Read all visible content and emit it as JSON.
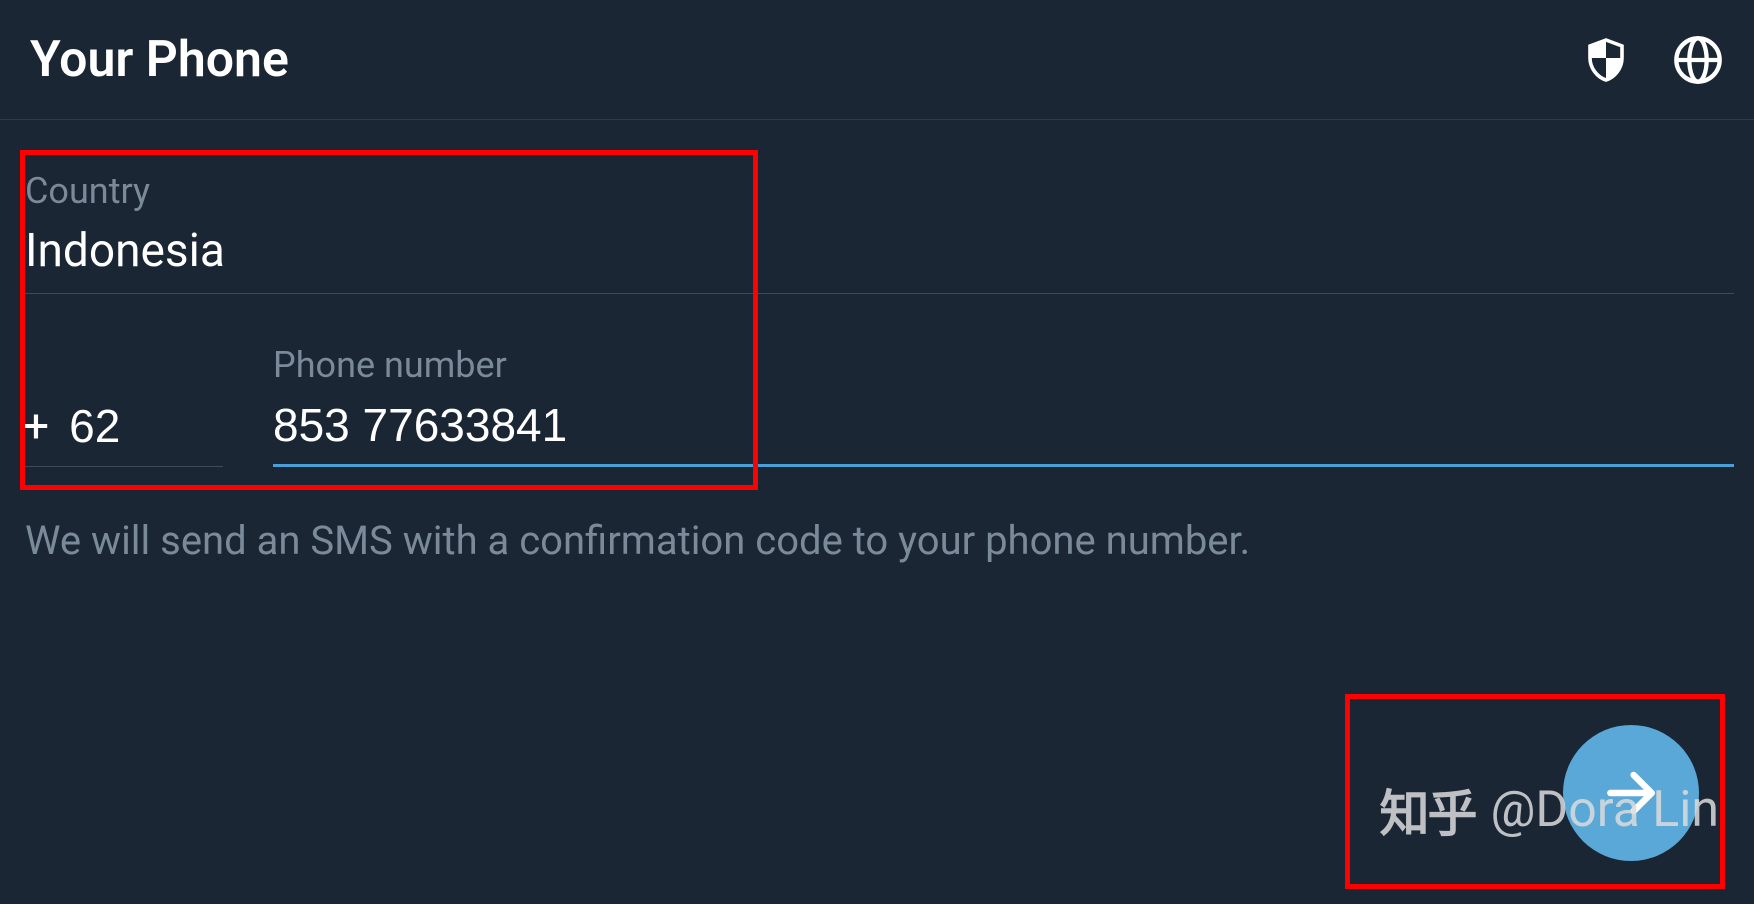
{
  "header": {
    "title": "Your Phone"
  },
  "country": {
    "label": "Country",
    "value": "Indonesia"
  },
  "phone": {
    "label": "Phone number",
    "prefix_symbol": "+",
    "country_code": "62",
    "number": "853 77633841"
  },
  "hint": "We will send an SMS with a confirmation code to your phone number.",
  "watermark": {
    "zhihu": "知乎",
    "author": "@Dora Lin"
  },
  "colors": {
    "background": "#1a2634",
    "accent": "#4a9fd8",
    "fab": "#5aa8d8",
    "text_primary": "#ffffff",
    "text_secondary": "#7a8a99",
    "highlight": "#ff0000"
  }
}
